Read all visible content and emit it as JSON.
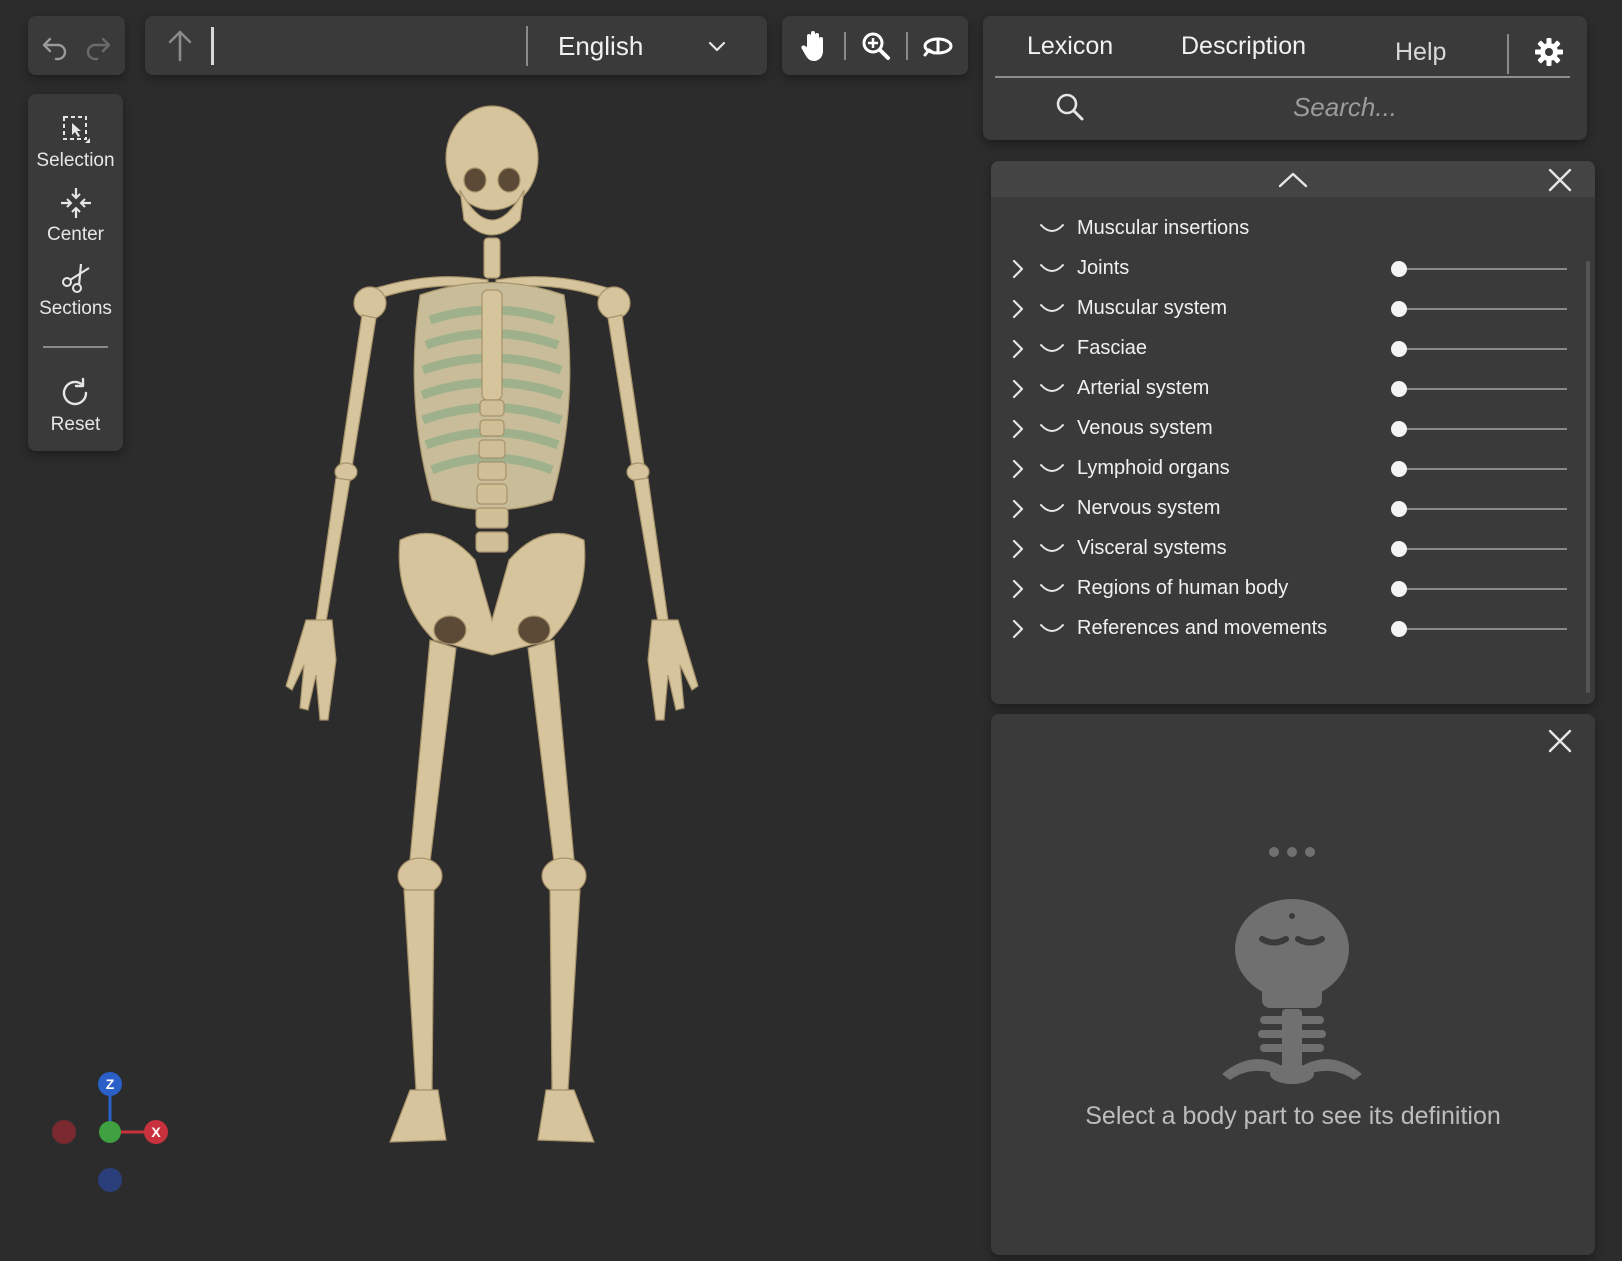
{
  "top_bar": {
    "language": "English"
  },
  "left_toolbar": {
    "items": [
      {
        "label": "Selection",
        "icon": "selection-icon"
      },
      {
        "label": "Center",
        "icon": "center-icon"
      },
      {
        "label": "Sections",
        "icon": "scissors-icon"
      },
      {
        "label": "Reset",
        "icon": "reset-icon"
      }
    ]
  },
  "right_panel": {
    "tabs": [
      "Lexicon",
      "Description",
      "Help"
    ],
    "search_placeholder": "Search..."
  },
  "systems_panel": {
    "rows": [
      {
        "label": "Muscular insertions",
        "expandable": false,
        "opacity": null
      },
      {
        "label": "Joints",
        "expandable": true,
        "opacity": 0
      },
      {
        "label": "Muscular system",
        "expandable": true,
        "opacity": 0
      },
      {
        "label": "Fasciae",
        "expandable": true,
        "opacity": 0
      },
      {
        "label": "Arterial system",
        "expandable": true,
        "opacity": 0
      },
      {
        "label": "Venous system",
        "expandable": true,
        "opacity": 0
      },
      {
        "label": "Lymphoid organs",
        "expandable": true,
        "opacity": 0
      },
      {
        "label": "Nervous system",
        "expandable": true,
        "opacity": 0
      },
      {
        "label": "Visceral systems",
        "expandable": true,
        "opacity": 0
      },
      {
        "label": "Regions of human body",
        "expandable": true,
        "opacity": 0
      },
      {
        "label": "References and movements",
        "expandable": true,
        "opacity": 0
      }
    ]
  },
  "definition_panel": {
    "message": "Select a body part to see its definition"
  },
  "axis_gizmo": {
    "z_label": "Z",
    "x_label": "X",
    "colors": {
      "x": "#c8323c",
      "y": "#3fa03f",
      "z": "#2a5fc8"
    }
  },
  "colors": {
    "background": "#2c2c2c",
    "panel": "#3a3a3a",
    "bone": "#d9c7a0",
    "cartilage": "#a8b89a"
  }
}
